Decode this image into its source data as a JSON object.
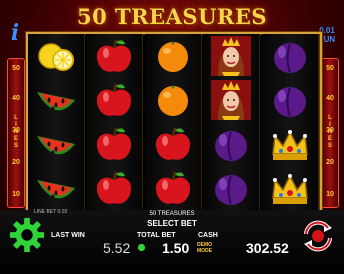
{
  "title": "50 TREASURES",
  "info_label": "i",
  "denomination": {
    "value": "0.01",
    "currency": "FUN"
  },
  "lines_panel": {
    "word": "LINES",
    "numbers": [
      "50",
      "40",
      "30",
      "20",
      "10"
    ]
  },
  "reels": [
    [
      "lemon",
      "watermelon",
      "watermelon",
      "watermelon"
    ],
    [
      "apple",
      "apple",
      "apple",
      "apple"
    ],
    [
      "orange",
      "orange",
      "apple",
      "apple"
    ],
    [
      "queen",
      "queen",
      "plum",
      "plum"
    ],
    [
      "plum",
      "plum",
      "crown",
      "crown"
    ]
  ],
  "bottom_bar": {
    "line_bet_text": "LINE BET 0.03",
    "game_name": "50 TREASURES",
    "select_bet_label": "SELECT BET",
    "last_win_label": "LAST WIN",
    "last_win_value": "5.52",
    "total_bet_label": "TOTAL BET",
    "total_bet_value": "1.50",
    "mode_label_1": "DEMO",
    "mode_label_2": "MODE",
    "cash_label": "CASH",
    "cash_value": "302.52"
  },
  "icons": {
    "settings": "gear-icon",
    "spin": "autoplay-arrows-icon",
    "bet_stepper": "green-dot-icon"
  },
  "colors": {
    "title": "#ffd24a",
    "accent_blue": "#3a8cff",
    "frame_gold": "#d6a43a",
    "spin_red": "#d0141a",
    "settings_green": "#2fd43a"
  }
}
